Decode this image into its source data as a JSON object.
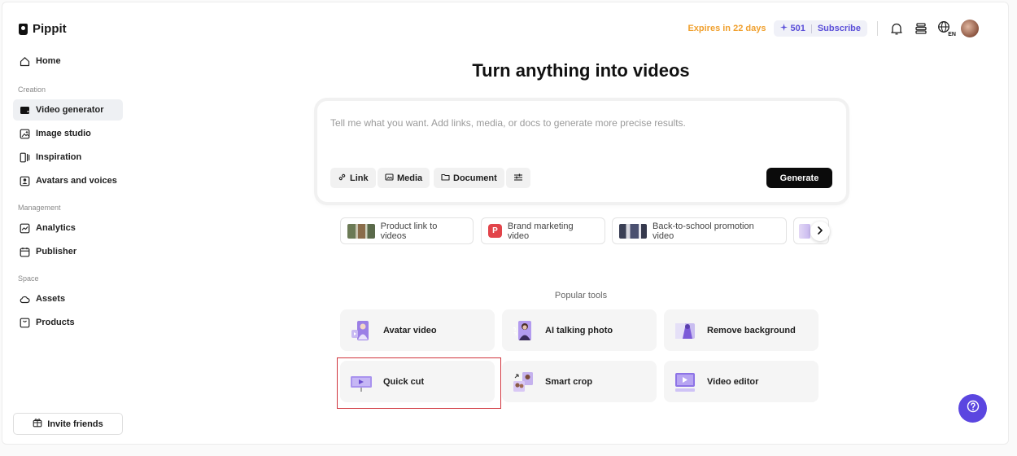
{
  "app": {
    "name": "Pippit"
  },
  "sidebar": {
    "home": "Home",
    "sections": {
      "creation": "Creation",
      "management": "Management",
      "space": "Space"
    },
    "creation_items": [
      "Video generator",
      "Image studio",
      "Inspiration",
      "Avatars and voices"
    ],
    "management_items": [
      "Analytics",
      "Publisher"
    ],
    "space_items": [
      "Assets",
      "Products"
    ],
    "active": "Video generator",
    "invite": "Invite friends"
  },
  "header": {
    "expires": "Expires in 22 days",
    "credits": "501",
    "subscribe": "Subscribe",
    "language_badge": "EN",
    "icons": [
      "bell-icon",
      "stack-icon",
      "globe-icon",
      "avatar"
    ]
  },
  "main": {
    "title": "Turn anything into videos",
    "prompt_placeholder": "Tell me what you want. Add links, media, or docs to generate more precise results.",
    "buttons": {
      "link": "Link",
      "media": "Media",
      "document": "Document",
      "generate": "Generate"
    },
    "suggestions": [
      "Product link to videos",
      "Brand marketing video",
      "Back-to-school promotion video"
    ],
    "brand_badge": "P",
    "popular_title": "Popular tools",
    "tools": [
      "Avatar video",
      "AI talking photo",
      "Remove background",
      "Quick cut",
      "Smart crop",
      "Video editor"
    ],
    "selected_tool": "Quick cut"
  },
  "colors": {
    "accent": "#5b46e0",
    "expires": "#f0a02e",
    "credits": "#5a4ed8",
    "generate_bg": "#0b0b0b",
    "selection_outline": "#d0353d",
    "brand_badge": "#e2444a"
  }
}
